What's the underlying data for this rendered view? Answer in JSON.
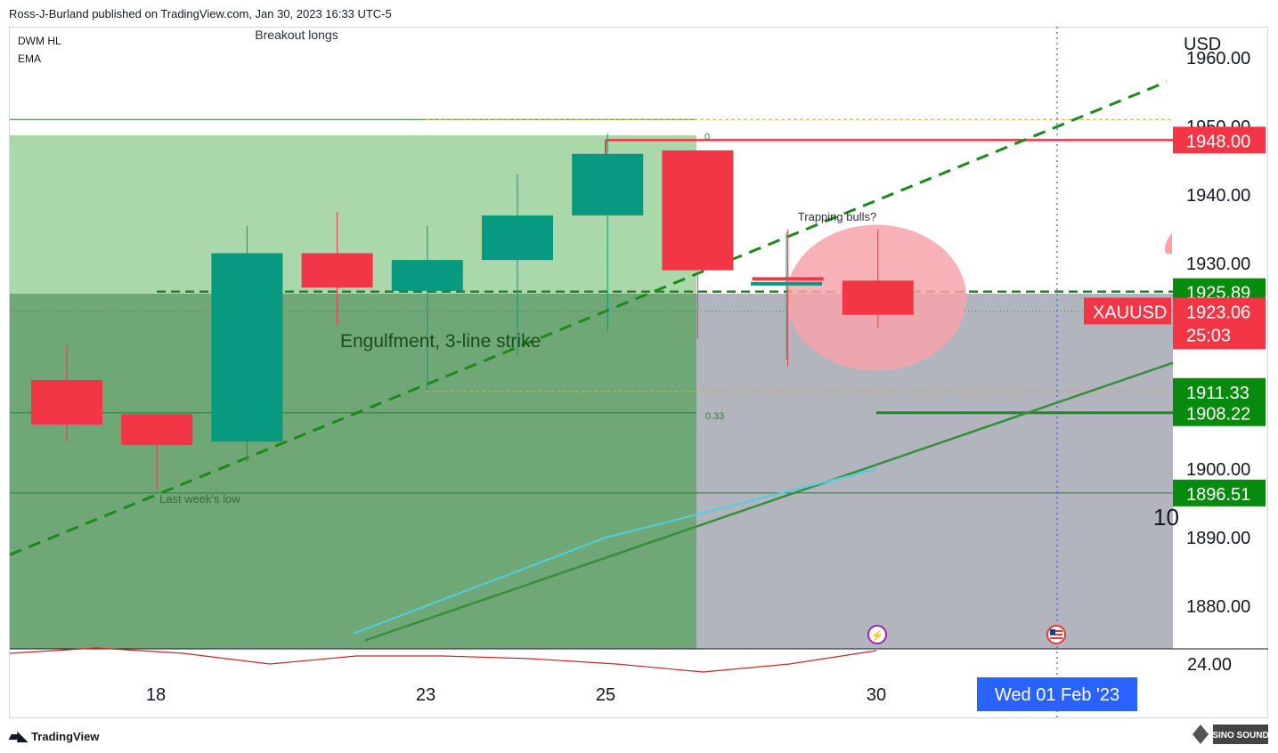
{
  "header": {
    "text": "Ross-J-Burland published on TradingView.com, Jan 30, 2023 16:33 UTC-5"
  },
  "footer": {
    "brand": "TradingView"
  },
  "watermark": {
    "text": "SINO SOUND"
  },
  "colors": {
    "up": "#089981",
    "down": "#f23645",
    "green_zone": "#a5d6a7",
    "grey_zone": "#b2b5be",
    "accent": "#2962ff"
  },
  "chart_data": {
    "type": "candlestick",
    "symbol": "XAUUSD",
    "currency": "USD",
    "indicators": [
      "DWM HL",
      "EMA"
    ],
    "x_ticks": [
      "18",
      "23",
      "25",
      "30"
    ],
    "crosshair_date": "Wed 01 Feb '23",
    "ylim": [
      1875,
      1962
    ],
    "y_ticks": [
      "1960.00",
      "1950.00",
      "1940.00",
      "1930.00",
      "1900.00",
      "1890.00",
      "1880.00"
    ],
    "candles": [
      {
        "x": 0,
        "o": 1913,
        "h": 1918,
        "l": 1904,
        "c": 1906.5
      },
      {
        "x": 1,
        "o": 1908,
        "h": 1908,
        "l": 1897,
        "c": 1903.5
      },
      {
        "x": 2,
        "o": 1904,
        "h": 1935.5,
        "l": 1901,
        "c": 1931.5
      },
      {
        "x": 3,
        "o": 1931.5,
        "h": 1937.5,
        "l": 1921,
        "c": 1926.5
      },
      {
        "x": 4,
        "o": 1926,
        "h": 1935.5,
        "l": 1911.5,
        "c": 1930.5
      },
      {
        "x": 5,
        "o": 1930.5,
        "h": 1943,
        "l": 1916.5,
        "c": 1937
      },
      {
        "x": 6,
        "o": 1937,
        "h": 1949,
        "l": 1920,
        "c": 1946
      },
      {
        "x": 7,
        "o": 1946.5,
        "h": 1946.5,
        "l": 1919,
        "c": 1929
      },
      {
        "x": 8,
        "o": 1928,
        "h": 1935,
        "l": 1915,
        "c": 1927.5
      },
      {
        "x": 9,
        "o": 1927.5,
        "h": 1935,
        "l": 1920.5,
        "c": 1922.5
      }
    ],
    "price_labels": [
      {
        "text": "1948.00",
        "value": 1948.0,
        "color": "#f23645"
      },
      {
        "text": "1925.89",
        "value": 1925.89,
        "color": "#078b0c"
      },
      {
        "text": "1923.06",
        "value": 1923.06,
        "color": "#f23645",
        "sub": "25:03"
      },
      {
        "text": "1911.33",
        "value": 1911.33,
        "color": "#078b0c"
      },
      {
        "text": "1908.22",
        "value": 1908.22,
        "color": "#078b0c"
      },
      {
        "text": "1896.51",
        "value": 1896.51,
        "color": "#078b0c"
      }
    ],
    "symbol_tag": "XAUUSD",
    "fib_labels": [
      "0",
      "0.33"
    ],
    "annotations": [
      "Breakout longs",
      "Trapping bulls?",
      "Engulfment, 3-line strike",
      "Last week's low"
    ],
    "ema_series": [
      1876,
      1890,
      1900
    ],
    "oscillator_label": "24.00",
    "oscillator_series": [
      31,
      33,
      31,
      27,
      30,
      30,
      29,
      27,
      24,
      27,
      32
    ]
  }
}
